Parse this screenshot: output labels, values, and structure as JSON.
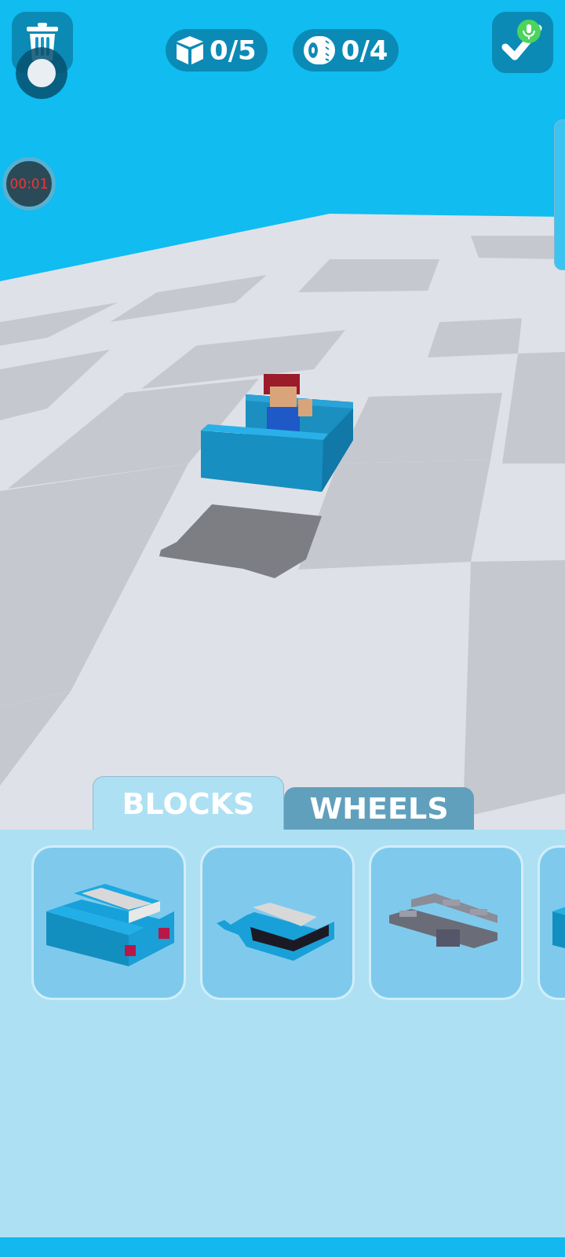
{
  "counters": [
    {
      "kind": "blocks",
      "text": "0/5"
    },
    {
      "kind": "wheels",
      "text": "0/4"
    }
  ],
  "timer": "00:01",
  "tabs": [
    {
      "label": "BLOCKS",
      "selected": true
    },
    {
      "label": "WHEELS",
      "selected": false
    }
  ],
  "parts": [
    {
      "kind": "body"
    },
    {
      "kind": "open-body"
    },
    {
      "kind": "frame"
    },
    {
      "kind": "body"
    }
  ]
}
